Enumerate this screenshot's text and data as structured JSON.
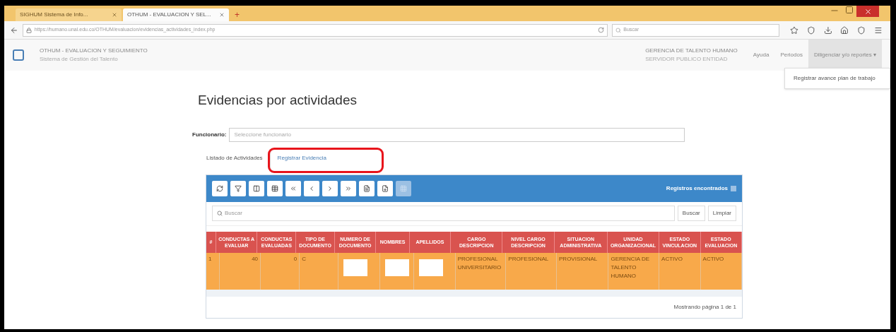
{
  "browser": {
    "tabs": [
      {
        "title": "SIGHUM Sistema de Info...",
        "selected": false
      },
      {
        "title": "OTHUM - EVALUACION Y SEL...",
        "selected": true
      }
    ],
    "new_tab": "+",
    "url": "https://humano.unal.edu.co/OTHUM/evaluacion/evidencias_actividades_index.php",
    "search_placeholder": "Buscar"
  },
  "app_header": {
    "title": "OTHUM - EVALUACION Y SEGUIMIENTO",
    "subtitle": "Sistema de Gestión del Talento",
    "unit": "GERENCIA DE TALENTO HUMANO",
    "user": "SERVIDOR PUBLICO ENTIDAD",
    "nav": [
      {
        "label": "Ayuda",
        "selected": false
      },
      {
        "label": "Periodos",
        "selected": false
      },
      {
        "label": "Diligenciar y/o reportes ▾",
        "selected": true
      }
    ],
    "dropdown": [
      "Registrar avance plan de trabajo"
    ]
  },
  "page_title": "Evidencias por actividades",
  "funcionario": {
    "label": "Funcionario:",
    "placeholder": "Seleccione funcionario"
  },
  "tabs": [
    {
      "label": "Listado de Actividades",
      "selected": true,
      "highlighted": false
    },
    {
      "label": "Registrar Evidencia",
      "selected": false,
      "highlighted": true
    }
  ],
  "grid": {
    "toolbar_buttons": [
      {
        "disabled": false
      },
      {
        "disabled": false
      },
      {
        "disabled": false
      },
      {
        "disabled": false
      },
      {
        "disabled": false
      },
      {
        "disabled": false
      },
      {
        "disabled": false
      },
      {
        "disabled": false
      },
      {
        "disabled": false
      },
      {
        "disabled": false
      },
      {
        "disabled": true
      }
    ],
    "records_label": "Registros encontrados",
    "search_placeholder": "Buscar",
    "buttons": [
      "Buscar",
      "Limpiar"
    ],
    "columns": [
      "#",
      "CONDUCTAS A EVALUAR",
      "CONDUCTAS EVALUADAS",
      "TIPO DE DOCUMENTO",
      "NUMERO DE DOCUMENTO",
      "NOMBRES",
      "APELLIDOS",
      "CARGO DESCRIPCION",
      "NIVEL CARGO DESCRIPCION",
      "SITUACION ADMINISTRATIVA",
      "UNIDAD ORGANIZACIONAL",
      "ESTADO VINCULACION",
      "ESTADO EVALUACION"
    ],
    "rows": [
      {
        "cells": [
          {
            "kind": "text",
            "text": "1"
          },
          {
            "kind": "number",
            "text": "40"
          },
          {
            "kind": "number",
            "text": "0"
          },
          {
            "kind": "text",
            "text": "C"
          },
          {
            "kind": "redacted"
          },
          {
            "kind": "redacted"
          },
          {
            "kind": "redacted"
          },
          {
            "kind": "text",
            "text": "PROFESIONAL UNIVERSITARIO"
          },
          {
            "kind": "text",
            "text": "PROFESIONAL"
          },
          {
            "kind": "text",
            "text": "PROVISIONAL"
          },
          {
            "kind": "text",
            "text": "GERENCIA DE TALENTO HUMANO"
          },
          {
            "kind": "text",
            "text": "ACTIVO"
          },
          {
            "kind": "text",
            "text": "ACTIVO"
          }
        ]
      }
    ],
    "footer": "Mostrando página 1 de 1"
  }
}
